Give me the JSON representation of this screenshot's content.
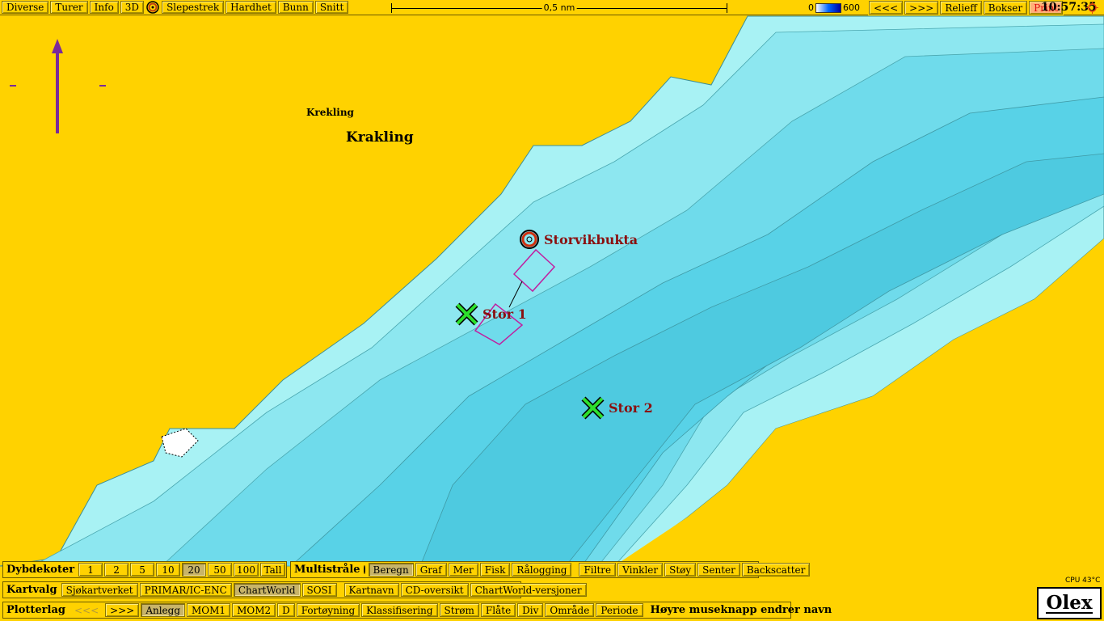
{
  "topbar": {
    "buttons": [
      "Diverse",
      "Turer",
      "Info",
      "3D"
    ],
    "buttons2": [
      "Slepestrek",
      "Hardhet",
      "Bunn",
      "Snitt"
    ],
    "scale_label": "0,5 nm",
    "depth_min": "0",
    "depth_max": "600",
    "nav": [
      "<<<",
      ">>>"
    ],
    "relief": "Relieff",
    "boxes": "Bokser",
    "print": "Print",
    "time": "10:57:35"
  },
  "map": {
    "place_small": "Krekling",
    "place_large": "Krakling",
    "marks": {
      "storvikbukta": "Storvikbukta",
      "stor1": "Stor 1",
      "stor2": "Stor 2"
    },
    "colors": {
      "land": "#ffd200",
      "shallow": "#a8f2f4",
      "deep": "#4ecfe4",
      "mark_label": "#8a1010",
      "mark_x": "#2de02d",
      "trap": "#c020a0"
    }
  },
  "dybdekoter": {
    "label": "Dybdekoter",
    "values": [
      "1",
      "2",
      "5",
      "10",
      "20",
      "50",
      "100",
      "Tall"
    ],
    "active": "20"
  },
  "multistraale": {
    "label": "Multistråle",
    "buttons": [
      "Beregn",
      "Graf",
      "Mer",
      "Fisk",
      "Rålogging",
      "Filtre",
      "Vinkler",
      "Støy",
      "Senter",
      "Backscatter"
    ],
    "active": "Beregn"
  },
  "kartvalg": {
    "label": "Kartvalg",
    "buttons": [
      "Sjøkartverket",
      "PRIMAR/IC-ENC",
      "ChartWorld",
      "SOSI",
      "Kartnavn",
      "CD-oversikt",
      "ChartWorld-versjoner"
    ],
    "active": "ChartWorld"
  },
  "plotterlag": {
    "label": "Plotterlag",
    "nav": [
      "<<<",
      ">>>"
    ],
    "buttons": [
      "Anlegg",
      "MOM1",
      "MOM2",
      "D",
      "Fortøyning",
      "Klassifisering",
      "Strøm",
      "Flåte",
      "Div",
      "Område",
      "Periode"
    ],
    "active": "Anlegg",
    "hint": "Høyre museknapp endrer navn"
  },
  "status": {
    "cpu": "CPU 43°C",
    "logo": "Olex"
  }
}
